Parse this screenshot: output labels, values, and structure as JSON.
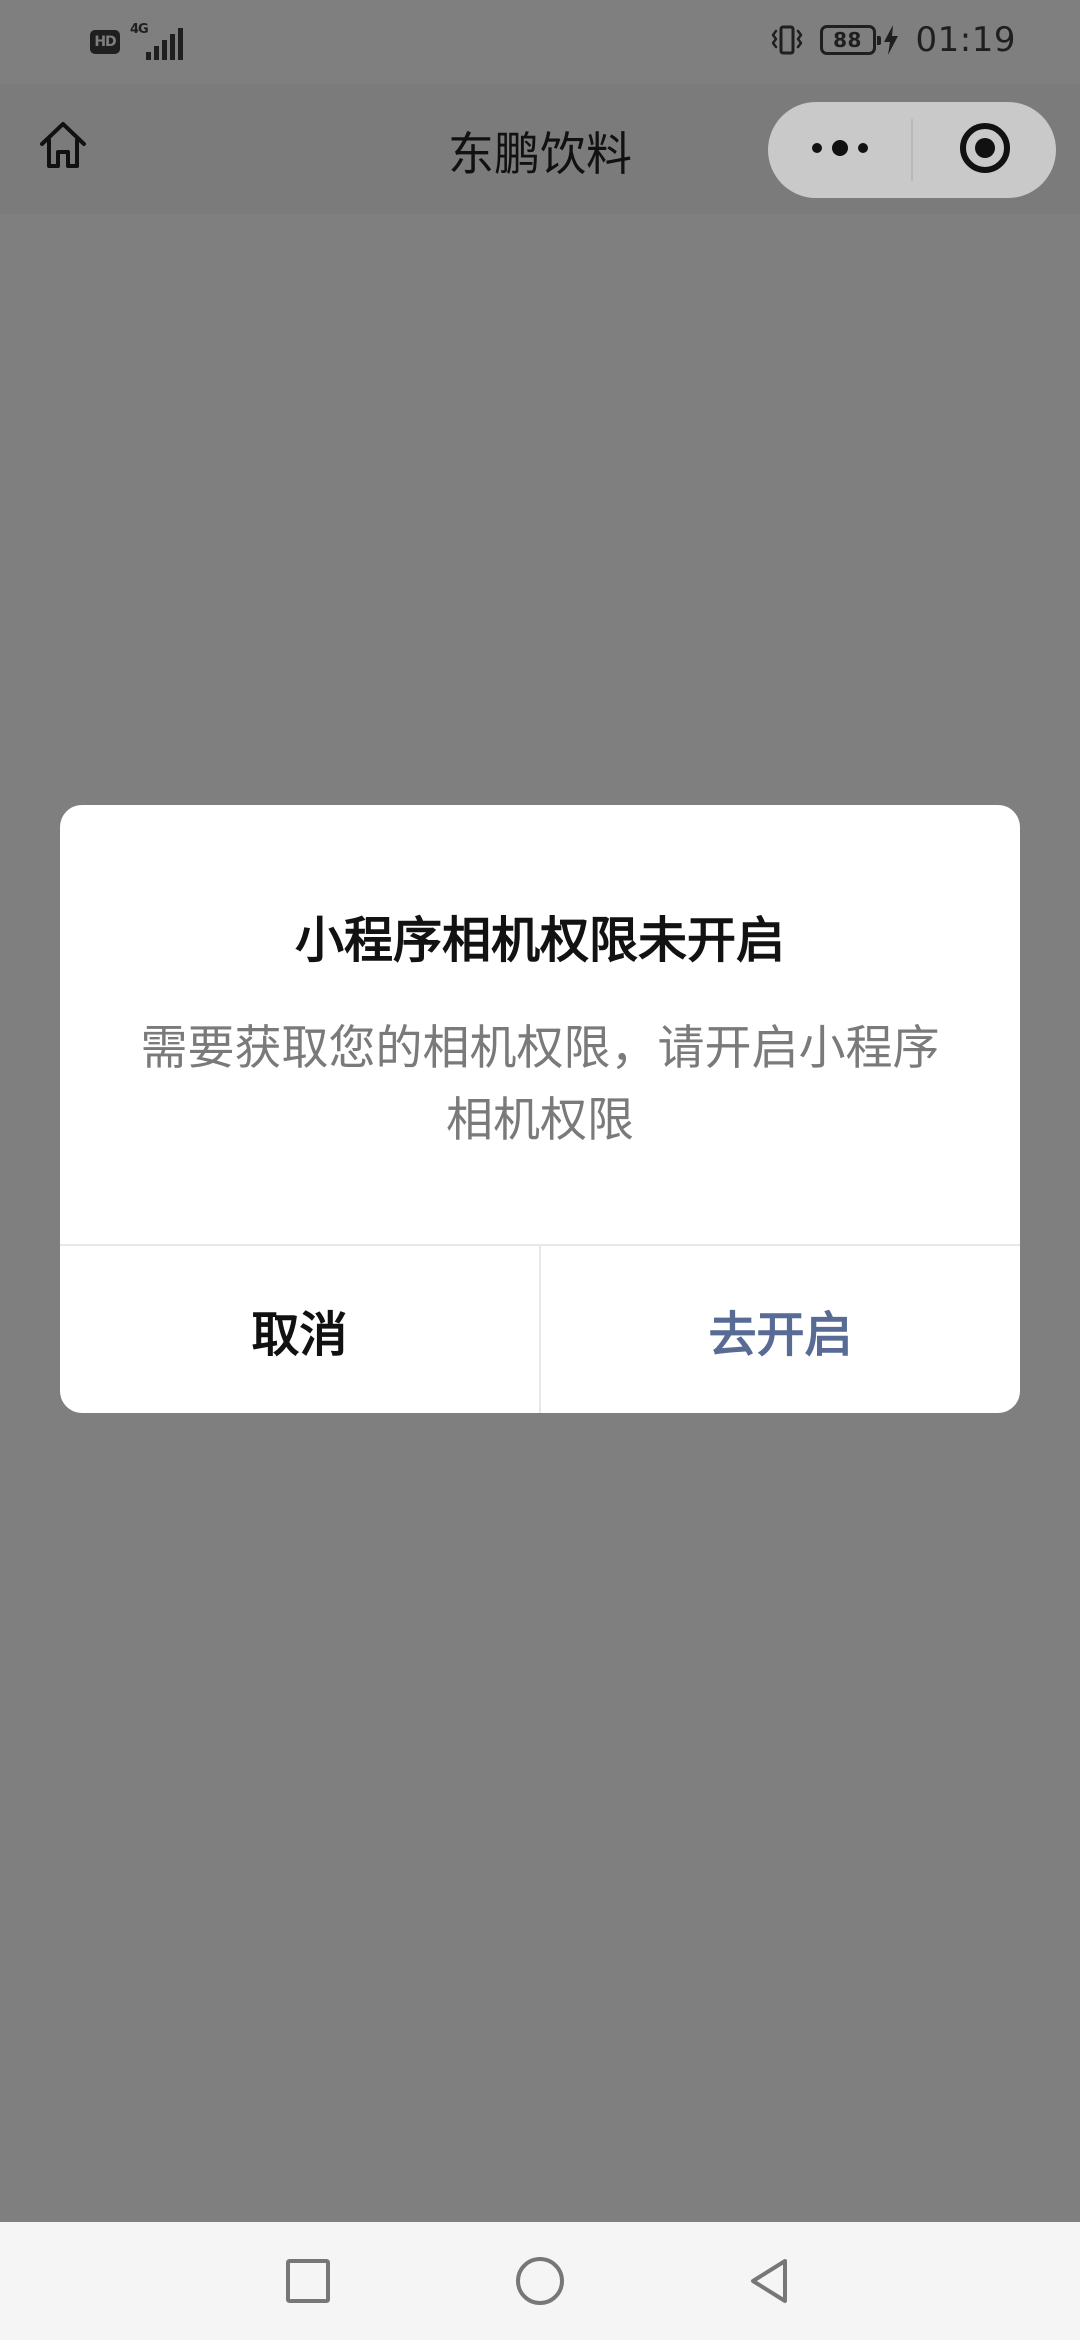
{
  "status_bar": {
    "hd": "HD",
    "network": "4G",
    "battery": "88",
    "time": "01:19"
  },
  "nav": {
    "title": "东鹏饮料"
  },
  "dialog": {
    "title": "小程序相机权限未开启",
    "message": "需要获取您的相机权限，请开启小程序相机权限",
    "cancel": "取消",
    "confirm": "去开启"
  },
  "icons": {
    "home": "home-icon",
    "more": "more-dots-icon",
    "record": "target-icon",
    "vibrate": "vibrate-icon",
    "charging": "charging-icon",
    "recent": "square-icon",
    "home_nav": "circle-icon",
    "back": "triangle-back-icon"
  },
  "colors": {
    "overlay": "#7f7f7f",
    "primary_action": "#576b95"
  }
}
